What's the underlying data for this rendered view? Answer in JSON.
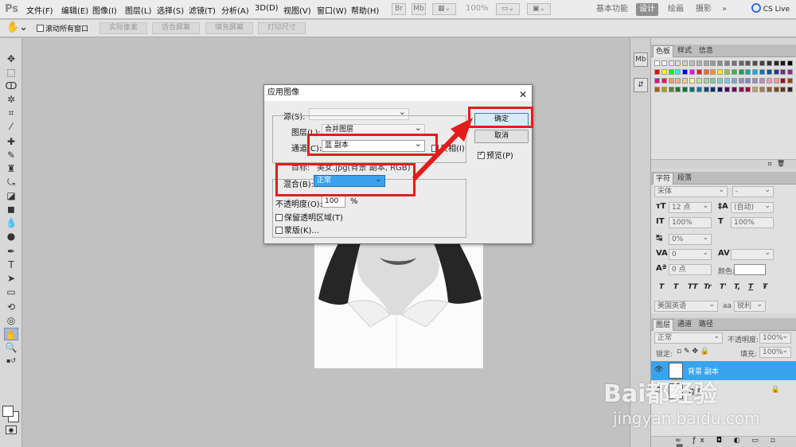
{
  "app": {
    "logo": "Ps"
  },
  "menu": {
    "items": [
      "文件(F)",
      "编辑(E)",
      "图像(I)",
      "图层(L)",
      "选择(S)",
      "滤镜(T)",
      "分析(A)",
      "3D(D)",
      "视图(V)",
      "窗口(W)",
      "帮助(H)"
    ],
    "zoom": "100%",
    "workspaces": [
      "基本功能",
      "设计",
      "绘画",
      "摄影"
    ],
    "active_workspace": "设计",
    "cslive": "CS Live"
  },
  "options": {
    "scroll_all": "滚动所有窗口",
    "buttons": [
      "实际像素",
      "适合屏幕",
      "填充屏幕",
      "打印尺寸"
    ]
  },
  "dialog": {
    "title": "应用图像",
    "source_label": "源(S):",
    "source_value": "",
    "layer_label": "图层(L):",
    "layer_value": "合并图层",
    "channel_label": "通道(C):",
    "channel_value": "蓝 副本",
    "invert_label": "反相(I)",
    "target_label": "目标:",
    "target_value": "美女.jpg(背景 副本, RGB)",
    "blend_label": "混合(B):",
    "blend_value": "正常",
    "opacity_label": "不透明度(O):",
    "opacity_value": "100",
    "opacity_unit": "%",
    "preserve_label": "保留透明区域(T)",
    "mask_label": "蒙版(K)...",
    "ok": "确定",
    "cancel": "取消",
    "preview_label": "预览(P)",
    "preview_checked": true
  },
  "color_panel": {
    "tabs": [
      "色板",
      "样式",
      "信息"
    ],
    "active": "色板"
  },
  "char_panel": {
    "tabs": [
      "字符",
      "段落"
    ],
    "font_family": "宋体",
    "font_style": "-",
    "size": "12 点",
    "leading": "(自动)",
    "v_scale": "100%",
    "h_scale": "100%",
    "tracking_pct": "0%",
    "kerning": "0",
    "baseline": "0 点",
    "color_label": "颜色:",
    "format_buttons": [
      "T",
      "T",
      "TT",
      "Tr",
      "T'",
      "T,",
      "T",
      "Ŧ"
    ],
    "language": "美国英语",
    "aa_prefix": "aa",
    "antialias": "锐利"
  },
  "layers_panel": {
    "tabs": [
      "图层",
      "通道",
      "路径"
    ],
    "blend_mode": "正常",
    "opacity_label": "不透明度:",
    "opacity": "100%",
    "lock_label": "锁定:",
    "fill_label": "填充:",
    "fill": "100%",
    "layers": [
      {
        "name": "背景 副本",
        "selected": true
      },
      {
        "name": "背景",
        "selected": false
      }
    ]
  },
  "watermark": {
    "brand": "Bai都经验",
    "url": "jingyan.baidu.com"
  },
  "swatch_colors": [
    "#ffffff",
    "#f2f2f2",
    "#e6e6e6",
    "#d9d9d9",
    "#cccccc",
    "#bfbfbf",
    "#b3b3b3",
    "#a6a6a6",
    "#999999",
    "#8c8c8c",
    "#808080",
    "#737373",
    "#666666",
    "#595959",
    "#4d4d4d",
    "#404040",
    "#333333",
    "#262626",
    "#1a1a1a",
    "#000000",
    "#ff0000",
    "#ffff00",
    "#00ff00",
    "#00ffff",
    "#0000ff",
    "#ff00ff",
    "#ee1d24",
    "#f26522",
    "#f7941d",
    "#fff200",
    "#8dc63f",
    "#39b54a",
    "#00a651",
    "#00a99d",
    "#00aeef",
    "#0072bc",
    "#0054a6",
    "#2e3192",
    "#662d91",
    "#92278f",
    "#ec008c",
    "#ed145b",
    "#f7977a",
    "#f9ad81",
    "#fdc68a",
    "#fff79a",
    "#c4df9b",
    "#a3d39c",
    "#82ca9d",
    "#7bcdc8",
    "#6ecff6",
    "#7da7d9",
    "#8393ca",
    "#8781bd",
    "#a187be",
    "#bd8cbf",
    "#f49ac2",
    "#f6989d",
    "#9e0b0f",
    "#a0410d",
    "#a3620a",
    "#aba000",
    "#598527",
    "#197b30",
    "#007236",
    "#00746b",
    "#0076a3",
    "#004b80",
    "#003471",
    "#1b1464",
    "#440e62",
    "#630460",
    "#9e005d",
    "#9e0039",
    "#c69c6d",
    "#a67c52",
    "#8c6239",
    "#754c24",
    "#603913",
    "#3c2415"
  ],
  "colors": {
    "red": "#e41c1c",
    "selection": "#39a3f0"
  }
}
